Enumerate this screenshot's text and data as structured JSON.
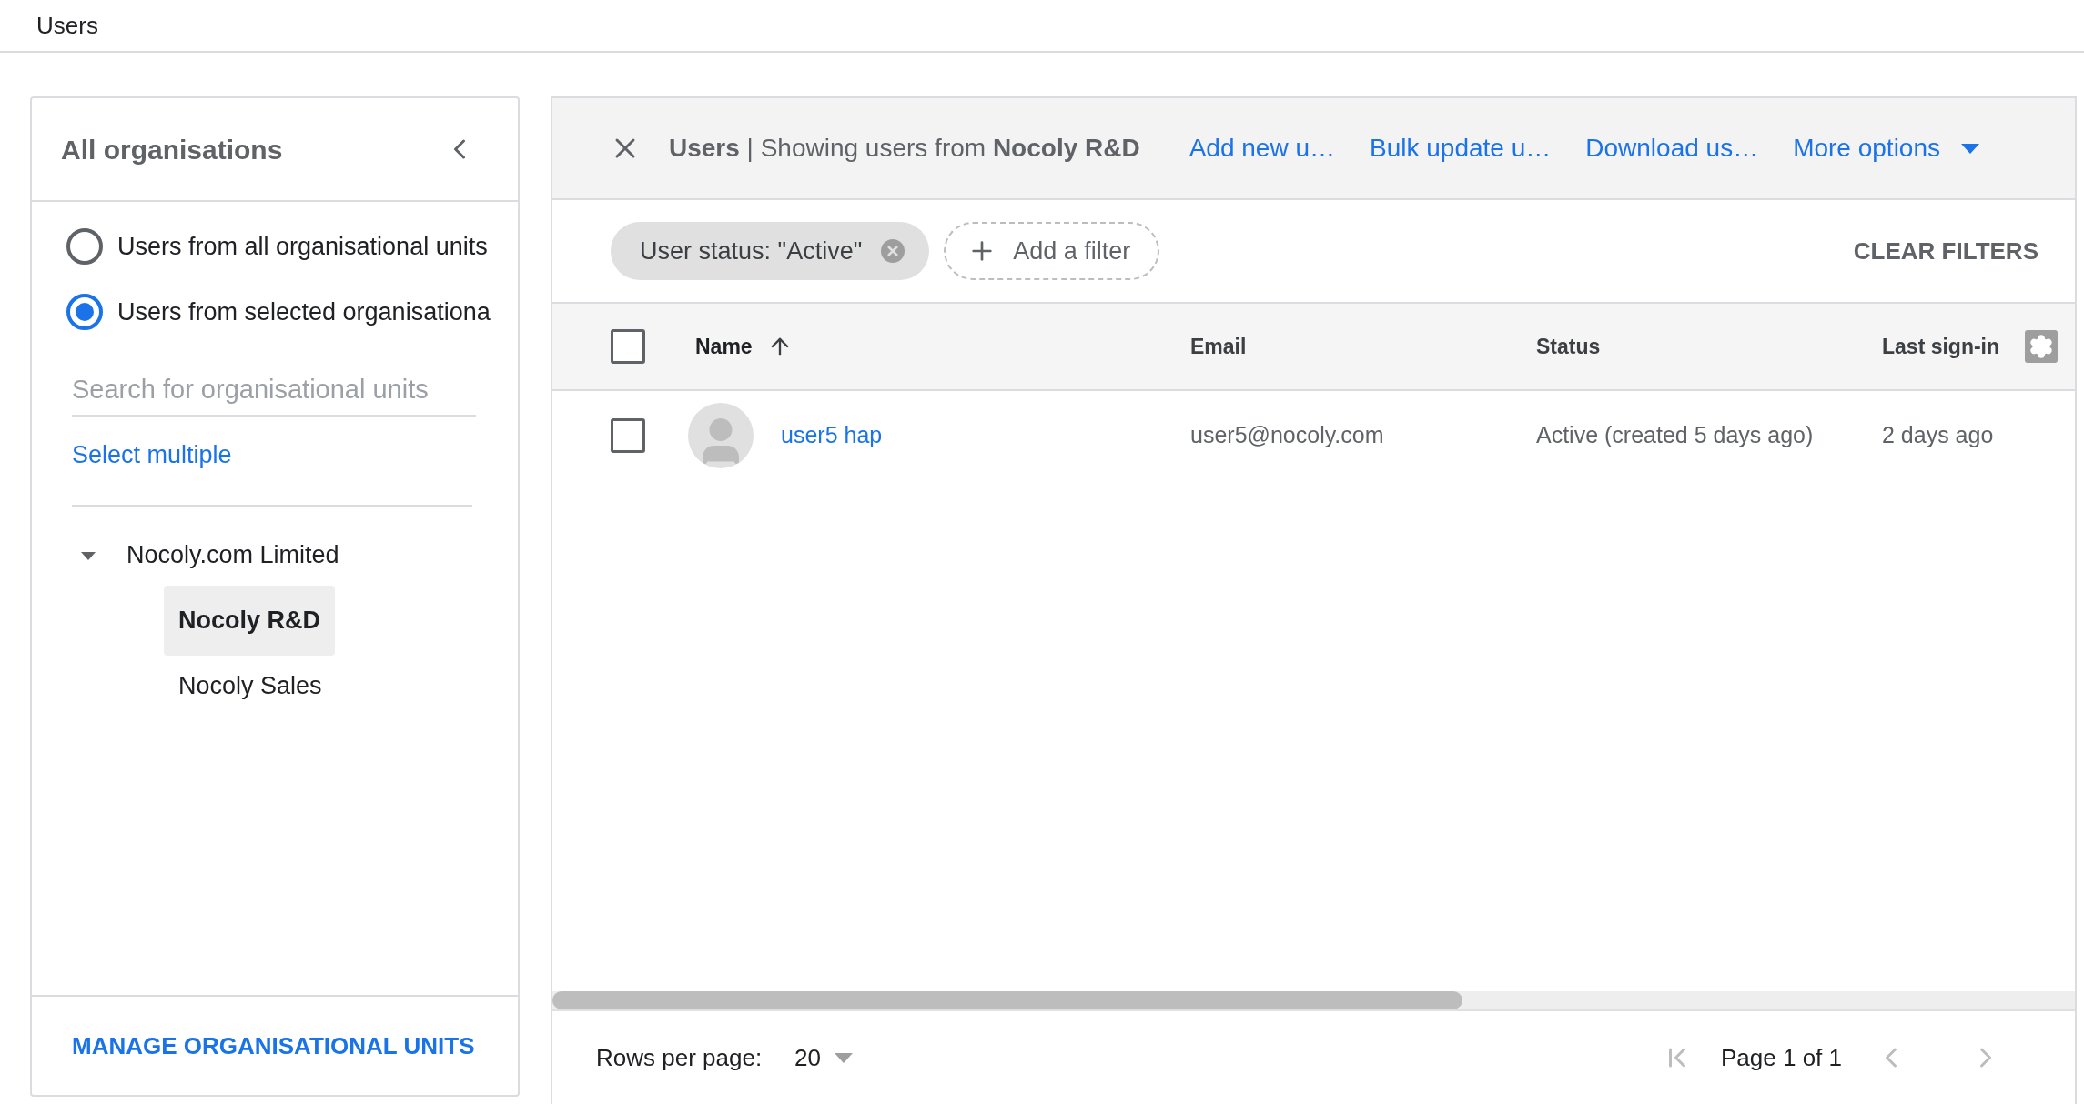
{
  "page_title": "Users",
  "org_panel": {
    "title": "All organisations",
    "scope_options": [
      {
        "label": "Users from all organisational units",
        "selected": false
      },
      {
        "label": "Users from selected organisationa",
        "selected": true
      }
    ],
    "search": {
      "placeholder": "Search for organisational units"
    },
    "select_multiple": "Select multiple",
    "tree": [
      {
        "label": "Nocoly.com Limited",
        "expanded": true,
        "selected": false,
        "children": [
          {
            "label": "Nocoly R&D",
            "selected": true
          },
          {
            "label": "Nocoly Sales",
            "selected": false
          }
        ]
      }
    ],
    "manage_button": "MANAGE ORGANISATIONAL UNITS"
  },
  "users_panel": {
    "heading": "**Users** | Showing users from **Nocoly R&D**",
    "actions": [
      "Add new u…",
      "Bulk update u…",
      "Download us…"
    ],
    "more_options": "More options",
    "filters": [
      {
        "label": "User status: \"Active\""
      }
    ],
    "add_filter": "Add a filter",
    "clear_filters": "CLEAR FILTERS",
    "table": {
      "select_all_checked": false,
      "columns": [
        {
          "label": "Name",
          "sorted": true
        },
        {
          "label": "Email",
          "sorted": false
        },
        {
          "label": "Status",
          "sorted": false
        },
        {
          "label": "Last sign-in",
          "sorted": false
        }
      ],
      "rows": [
        {
          "checked": false,
          "name": "user5 hap",
          "email": "user5@nocoly.com",
          "status": "Active (created 5 days ago)",
          "last_sign_in": "2 days ago"
        }
      ]
    },
    "pagination": {
      "rows_per_page_label": "Rows per page:",
      "rows_per_page": "20",
      "page": "Page 1 of 1"
    }
  }
}
